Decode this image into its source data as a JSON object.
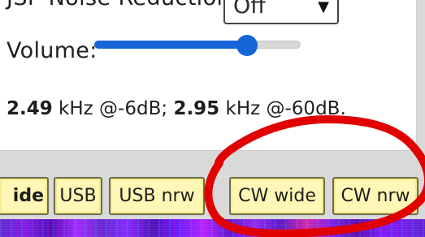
{
  "controls": {
    "noise_reduction_label": "JSP Noise Reduction:",
    "noise_reduction_value": "Off",
    "volume_label": "Volume:",
    "volume_level": 0.74
  },
  "bandwidth": {
    "value_1": "2.49",
    "text_1": " kHz @-6dB; ",
    "value_2": "2.95",
    "text_2": " kHz @-60dB."
  },
  "buttons": {
    "partial": "ide",
    "usb": "USB",
    "usb_nrw": "USB nrw",
    "cw_wide": "CW wide",
    "cw_nrw": "CW nrw"
  },
  "colors": {
    "button_fill": "#fff7b5",
    "slider_accent": "#1565d8",
    "annotation_red": "#e10000"
  },
  "icons": {
    "dropdown_arrow": "chevron-down-icon"
  }
}
